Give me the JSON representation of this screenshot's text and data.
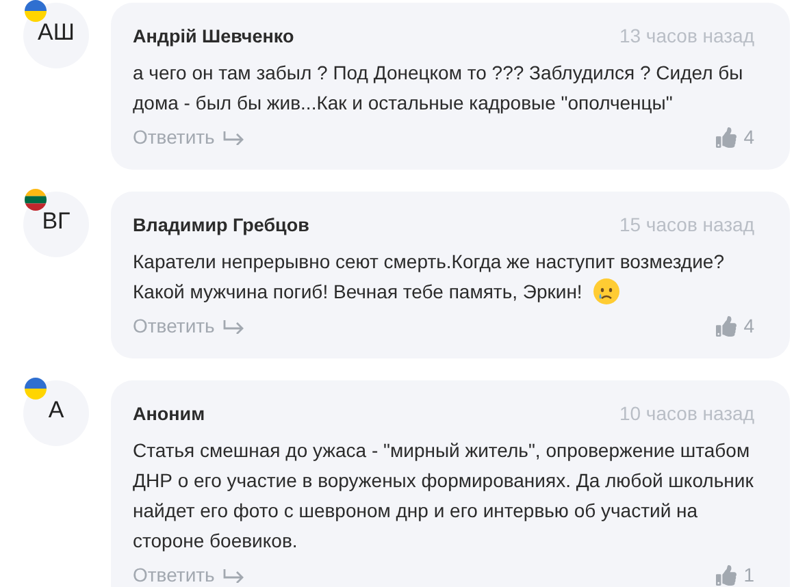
{
  "comments": [
    {
      "initials": "АШ",
      "flag": [
        {
          "color": "#2f6fd0"
        },
        {
          "color": "#ffd500"
        }
      ],
      "author": "Андрій Шевченко",
      "time": "13 часов назад",
      "text": "а чего он там забыл ? Под Донецком то ??? Заблудился ? Сидел бы дома - был бы жив...Как и остальные кадровые \"ополченцы\"",
      "reply": "Ответить",
      "likes": "4"
    },
    {
      "initials": "ВГ",
      "flag": [
        {
          "color": "#fdb913"
        },
        {
          "color": "#006a44"
        },
        {
          "color": "#c1272d"
        }
      ],
      "author": "Владимир Гребцов",
      "time": "15 часов назад",
      "text": "Каратели непрерывно сеют смерть.Когда же наступит возмездие? Какой мужчина погиб! Вечная тебе память, Эркин!",
      "trailing_icon": {
        "kind": "crying"
      },
      "reply": "Ответить",
      "likes": "4"
    },
    {
      "initials": "А",
      "flag": [
        {
          "color": "#2f6fd0"
        },
        {
          "color": "#ffd500"
        }
      ],
      "author": "Аноним",
      "time": "10 часов назад",
      "text": "Статья смешная до ужаса - \"мирный житель\", опровержение штабом ДНР о его участие в воруженых формированиях. Да любой школьник найдет его фото с шевроном днр и его интервью об участий на стороне боевиков.",
      "reply": "Ответить",
      "likes": "1"
    }
  ]
}
